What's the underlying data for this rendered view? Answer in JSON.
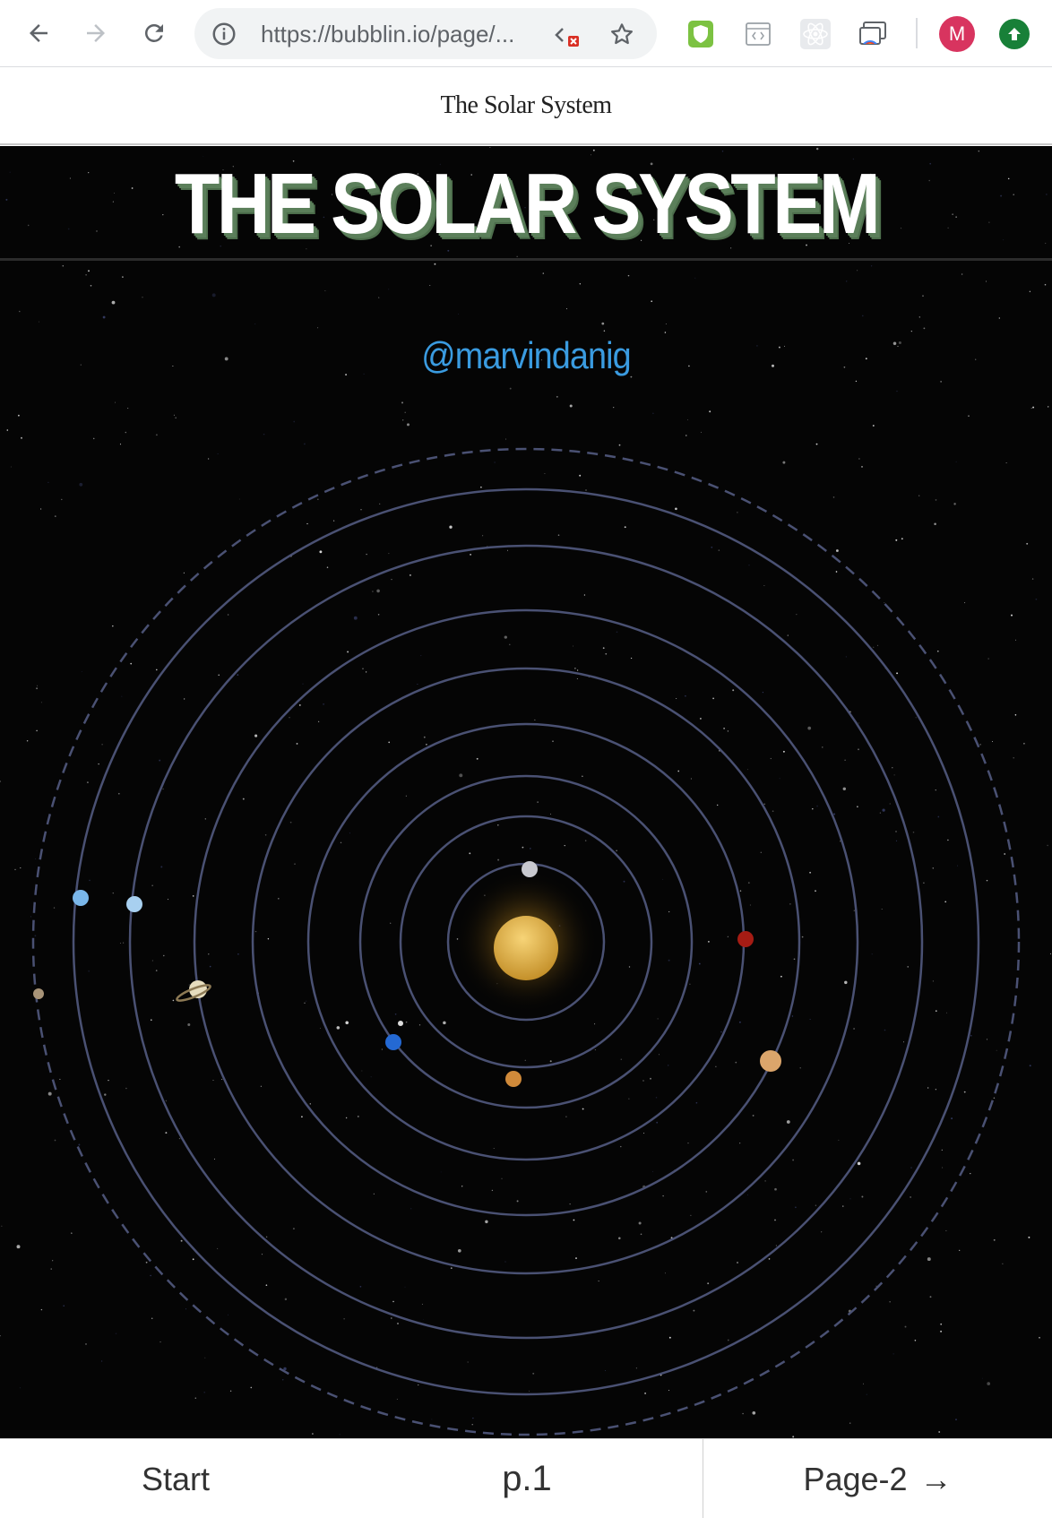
{
  "browser": {
    "url": "https://bubblin.io/page/...",
    "profile_initial": "M",
    "icons": {
      "back": "arrow-left-icon",
      "forward": "arrow-right-icon",
      "reload": "reload-icon",
      "info": "info-icon",
      "devtools": "code-blocked-icon",
      "bookmark": "star-icon",
      "ext1": "shield-icon",
      "ext2": "code-window-icon",
      "ext3": "react-atom-icon",
      "ext4": "cast-window-icon",
      "update": "update-arrow-icon"
    }
  },
  "page": {
    "header_title": "The Solar System",
    "banner_title": "THE SOLAR SYSTEM",
    "author": "@marvindanig"
  },
  "colors": {
    "author_link": "#3a9be0",
    "banner_shadow": "#5b7f5a",
    "orbit": "#4a5173",
    "sun_core": "#e6b84a"
  },
  "footer": {
    "start_label": "Start",
    "page_label": "p.1",
    "next_label": "Page-2",
    "next_arrow": "→"
  }
}
